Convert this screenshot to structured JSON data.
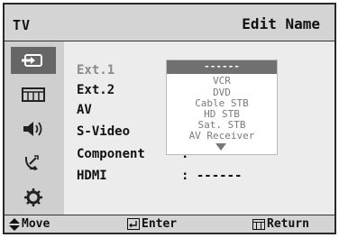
{
  "header": {
    "source": "TV",
    "title": "Edit Name"
  },
  "sidebar": {
    "items": [
      {
        "icon": "input-icon",
        "active": true
      },
      {
        "icon": "picture-icon",
        "active": false
      },
      {
        "icon": "sound-icon",
        "active": false
      },
      {
        "icon": "channel-icon",
        "active": false
      },
      {
        "icon": "setup-icon",
        "active": false
      }
    ]
  },
  "menu": {
    "rows": [
      {
        "label": "Ext.1",
        "value": "",
        "dim": true
      },
      {
        "label": "Ext.2",
        "value": ""
      },
      {
        "label": "AV",
        "value": ""
      },
      {
        "label": "S-Video",
        "value": ""
      },
      {
        "label": "Component",
        "value": ": ------"
      },
      {
        "label": "HDMI",
        "value": ": ------"
      }
    ]
  },
  "dropdown": {
    "selected": "------",
    "options": [
      "VCR",
      "DVD",
      "Cable STB",
      "HD STB",
      "Sat. STB",
      "AV Receiver"
    ]
  },
  "footer": {
    "move": "Move",
    "enter": "Enter",
    "return": "Return"
  },
  "colors": {
    "active_bg": "#666666",
    "frame": "#2a2a2a"
  }
}
